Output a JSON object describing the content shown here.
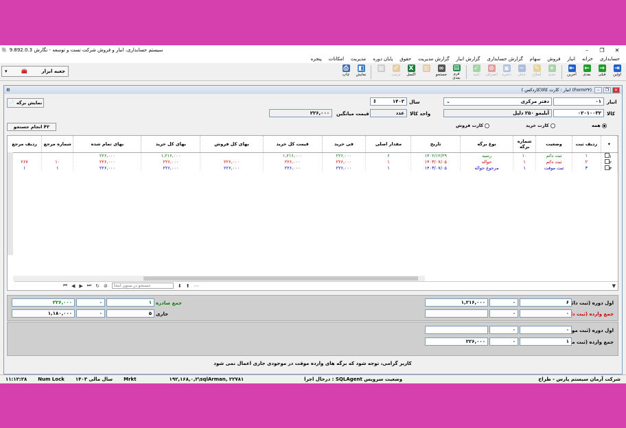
{
  "window": {
    "title": "سیستم حسابداری، انبار و فروش شرکت تست و توسعه - نگارش 9.892.0.3"
  },
  "menu": [
    "حسابداری",
    "خزانه",
    "انبار",
    "فروش",
    "سهام",
    "گزارش حسابداری",
    "گزارش انبار",
    "گزارش مدیریت",
    "حقوق",
    "پایان دوره",
    "مدیریت",
    "امکانات",
    "پنجره"
  ],
  "toolbar": {
    "tools_label": "جعبه ابزار",
    "buttons": [
      {
        "label": "اولین",
        "icon": "first-icon",
        "color": "#1e5fc9",
        "enabled": true
      },
      {
        "label": "قبلی",
        "icon": "prev-icon",
        "color": "#1e9c2a",
        "enabled": true
      },
      {
        "label": "بعدی",
        "icon": "next-icon",
        "color": "#1e9c2a",
        "enabled": true
      },
      {
        "label": "آخرین",
        "icon": "last-icon",
        "color": "#1e5fc9",
        "enabled": true
      },
      {
        "label": "جدید",
        "icon": "add-icon",
        "color": "#2a9c2a",
        "enabled": false
      },
      {
        "label": "اصلاح",
        "icon": "edit-icon",
        "color": "#d0a000",
        "enabled": false
      },
      {
        "label": "حذف",
        "icon": "delete-icon",
        "color": "#3060c0",
        "enabled": false
      },
      {
        "label": "ذخیره",
        "icon": "save-icon",
        "color": "#3060c0",
        "enabled": false
      },
      {
        "label": "انصراف",
        "icon": "cancel-icon",
        "color": "#c00",
        "enabled": false
      },
      {
        "label": "تایید",
        "icon": "check-icon",
        "color": "#1e9c2a",
        "enabled": false
      },
      {
        "label": "فرم بعدی",
        "icon": "form-icon",
        "color": "#1e8a4a",
        "enabled": true
      },
      {
        "label": "جستجو",
        "icon": "binoculars-icon",
        "color": "#555",
        "enabled": true
      },
      {
        "label": "",
        "icon": "doc-icon",
        "color": "#d08000",
        "enabled": false
      },
      {
        "label": "اکسل",
        "icon": "excel-icon",
        "color": "#1e7a3a",
        "enabled": true
      },
      {
        "label": "ترتیب",
        "icon": "pen-icon",
        "color": "#d09000",
        "enabled": false
      },
      {
        "label": "",
        "icon": "grid-icon",
        "color": "#888",
        "enabled": false
      },
      {
        "label": "نمایش",
        "icon": "preview-icon",
        "color": "#3a7ac0",
        "enabled": true
      },
      {
        "label": "چاپ",
        "icon": "print-icon",
        "color": "#3a6ab0",
        "enabled": true
      }
    ]
  },
  "inner_title": "انبار : کارت کالا(کاردکس ) (Form۲۴)",
  "form": {
    "warehouse_label": "انبار",
    "warehouse_code": "۰۱",
    "warehouse_name": "دفتر مرکزی",
    "year_label": "سال",
    "year": "۱۴۰۳",
    "item_label": "کالا",
    "item_code": "۰۲۰۱۰۰۳۲",
    "item_name": "آبلیمو ۲۵۰ دلپل",
    "unit_label": "واحد کالا",
    "unit": "عدد",
    "avg_price_label": "قیمت میانگین",
    "avg_price": "۲۲۶,۰۰۰",
    "show_doc_button": "نمایش برگه",
    "search_button": "انجام جستجو F۲",
    "radio_all": "همه",
    "radio_buy": "کارت خرید",
    "radio_sell": "کارت فروش"
  },
  "grid": {
    "headers": [
      "ردیف ثبت",
      "وضعیت",
      "شماره برگه",
      "نوع برگه",
      "تاریخ",
      "مقدار اصلی",
      "فی خرید",
      "قیمت کل خرید",
      "بهای کل فروش",
      "بهای کل خرید",
      "بهای تمام شده",
      "شماره مرجع",
      "ردیف مرجع"
    ],
    "rows": [
      {
        "row": "۱",
        "status": "ثبت دائم",
        "doc_no": "۱۰",
        "doc_type": "رسید",
        "date": "۱۴۰۲/۱۲/۲۹",
        "qty": "۶",
        "unit_price": "۲۲۶,۰۰۰",
        "total_buy_price": "۱,۲۱۶,۰۰۰",
        "total_sell": "",
        "total_buy": "۱,۲۱۶,۰۰۰",
        "cost": "۲۲۶,۰۰۰",
        "ref_no": "",
        "ref_row": ""
      },
      {
        "row": "۲",
        "status": "ثبت دائم",
        "doc_no": "۱",
        "doc_type": "حواله",
        "date": "۱۴۰۳/۰۷/۰۵",
        "qty": "۱",
        "unit_price": "۲۲۶,۰۰۰",
        "total_buy_price": "۲۲۶,۰۰۰",
        "total_sell": "۲۲۶,۰۰۰",
        "total_buy": "۲۲۶,۰۰۰",
        "cost": "۲۲۶,۰۰۰",
        "ref_no": "۱۰",
        "ref_row": "۲۶۷"
      },
      {
        "row": "۳",
        "status": "ثبت موقت",
        "doc_no": "۱",
        "doc_type": "مرجوع حواله",
        "date": "۱۴۰۳/۰۷/۰۵",
        "qty": "۱",
        "unit_price": "۲۲۶,۰۰۰",
        "total_buy_price": "۲۲۶,۰۰۰",
        "total_sell": "۲۲۶,۰۰۰",
        "total_buy": "۲۲۶,۰۰۰",
        "cost": "۲۲۶,۰۰۰",
        "ref_no": "۱",
        "ref_row": "۱"
      }
    ],
    "search_placeholder": "جستجو در ستون انتخا"
  },
  "summary": {
    "begin_perm_label": "اول دوره (ثبت دائم)",
    "begin_perm_qty": "۶",
    "begin_perm_amount": "۱,۲۱۶,۰۰۰",
    "begin_perm_zero": "۰",
    "in_perm_label": "جمع وارده (ثبت دائم)",
    "in_perm_zero": "۰",
    "out_label": "جمع صادره",
    "out_qty": "۱",
    "out_amount": "۲۲۶,۰۰۰",
    "out_zero": "۰",
    "current_label": "جاری",
    "current_qty": "۵",
    "current_amount": "۱,۱۸۰,۰۰۰",
    "current_zero": "۰",
    "begin_temp_label": "اول دوره (ثبت موقت)",
    "begin_temp_zero": "۰",
    "in_temp_label": "جمع وارده (ثبت موقت)",
    "in_temp_qty": "۱",
    "in_temp_amount": "۲۲۶,۰۰۰",
    "in_temp_zero": "۰"
  },
  "message": "کاربر گرامی، توجه شود که برگه های وارده موقت در موجودی جاری اعمال نمی شود",
  "status": {
    "company": "شرکت آرمان سیستم پارس - طراح",
    "service": "درحال اجرا : SQLAgent وضعیت سرویس",
    "server": "۱۹۲,۱۶۸,۰,۲\\sqlArman, ۲۲۷۸۱",
    "user": "Mrkt",
    "fiscal_year": "سال مالی ۱۴۰۳",
    "numlock": "Num Lock",
    "time": "۱۱:۱۲:۲۸"
  }
}
